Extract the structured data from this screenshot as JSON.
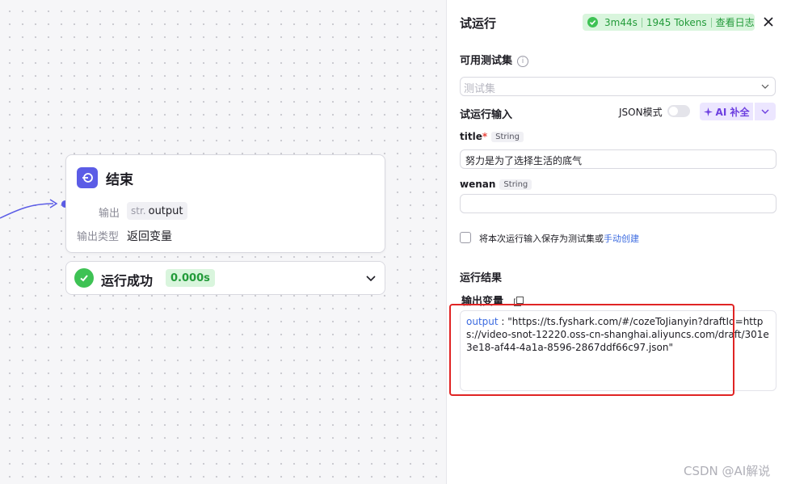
{
  "canvas": {
    "node": {
      "title": "结束",
      "output_label": "输出",
      "output_type_prefix": "str.",
      "output_name": "output",
      "output_type_label": "输出类型",
      "output_type_value": "返回变量"
    },
    "result": {
      "text": "运行成功",
      "time": "0.000s"
    }
  },
  "panel": {
    "title": "试运行",
    "status": {
      "duration": "3m44s",
      "tokens": "1945 Tokens",
      "log_link": "查看日志"
    },
    "testset": {
      "label": "可用测试集",
      "placeholder": "测试集"
    },
    "input_section": {
      "label": "试运行输入",
      "json_mode_label": "JSON模式",
      "json_mode_on": false,
      "ai_button": "AI 补全"
    },
    "fields": [
      {
        "name": "title",
        "required": true,
        "type": "String",
        "value": "努力是为了选择生活的底气"
      },
      {
        "name": "wenan",
        "required": false,
        "type": "String",
        "value": ""
      }
    ],
    "save_checkbox": {
      "text": "将本次运行输入保存为测试集或",
      "link": "手动创建",
      "checked": false
    },
    "result_section": {
      "label": "运行结果",
      "output_var_label": "输出变量",
      "output_key": "output",
      "output_value": "\"https://ts.fyshark.com/#/cozeToJianyin?draftId=https://video-snot-12220.oss-cn-shanghai.aliyuncs.com/draft/301e3e18-af44-4a1a-8596-2867ddf66c97.json\""
    }
  },
  "watermark": "CSDN @AI解说",
  "colors": {
    "accent": "#5b5ce6",
    "success": "#3ec254",
    "success_bg": "#d9f5dd",
    "ai_purple": "#6d3fe0",
    "highlight_red": "#e02424",
    "link_blue": "#3c6be0"
  }
}
